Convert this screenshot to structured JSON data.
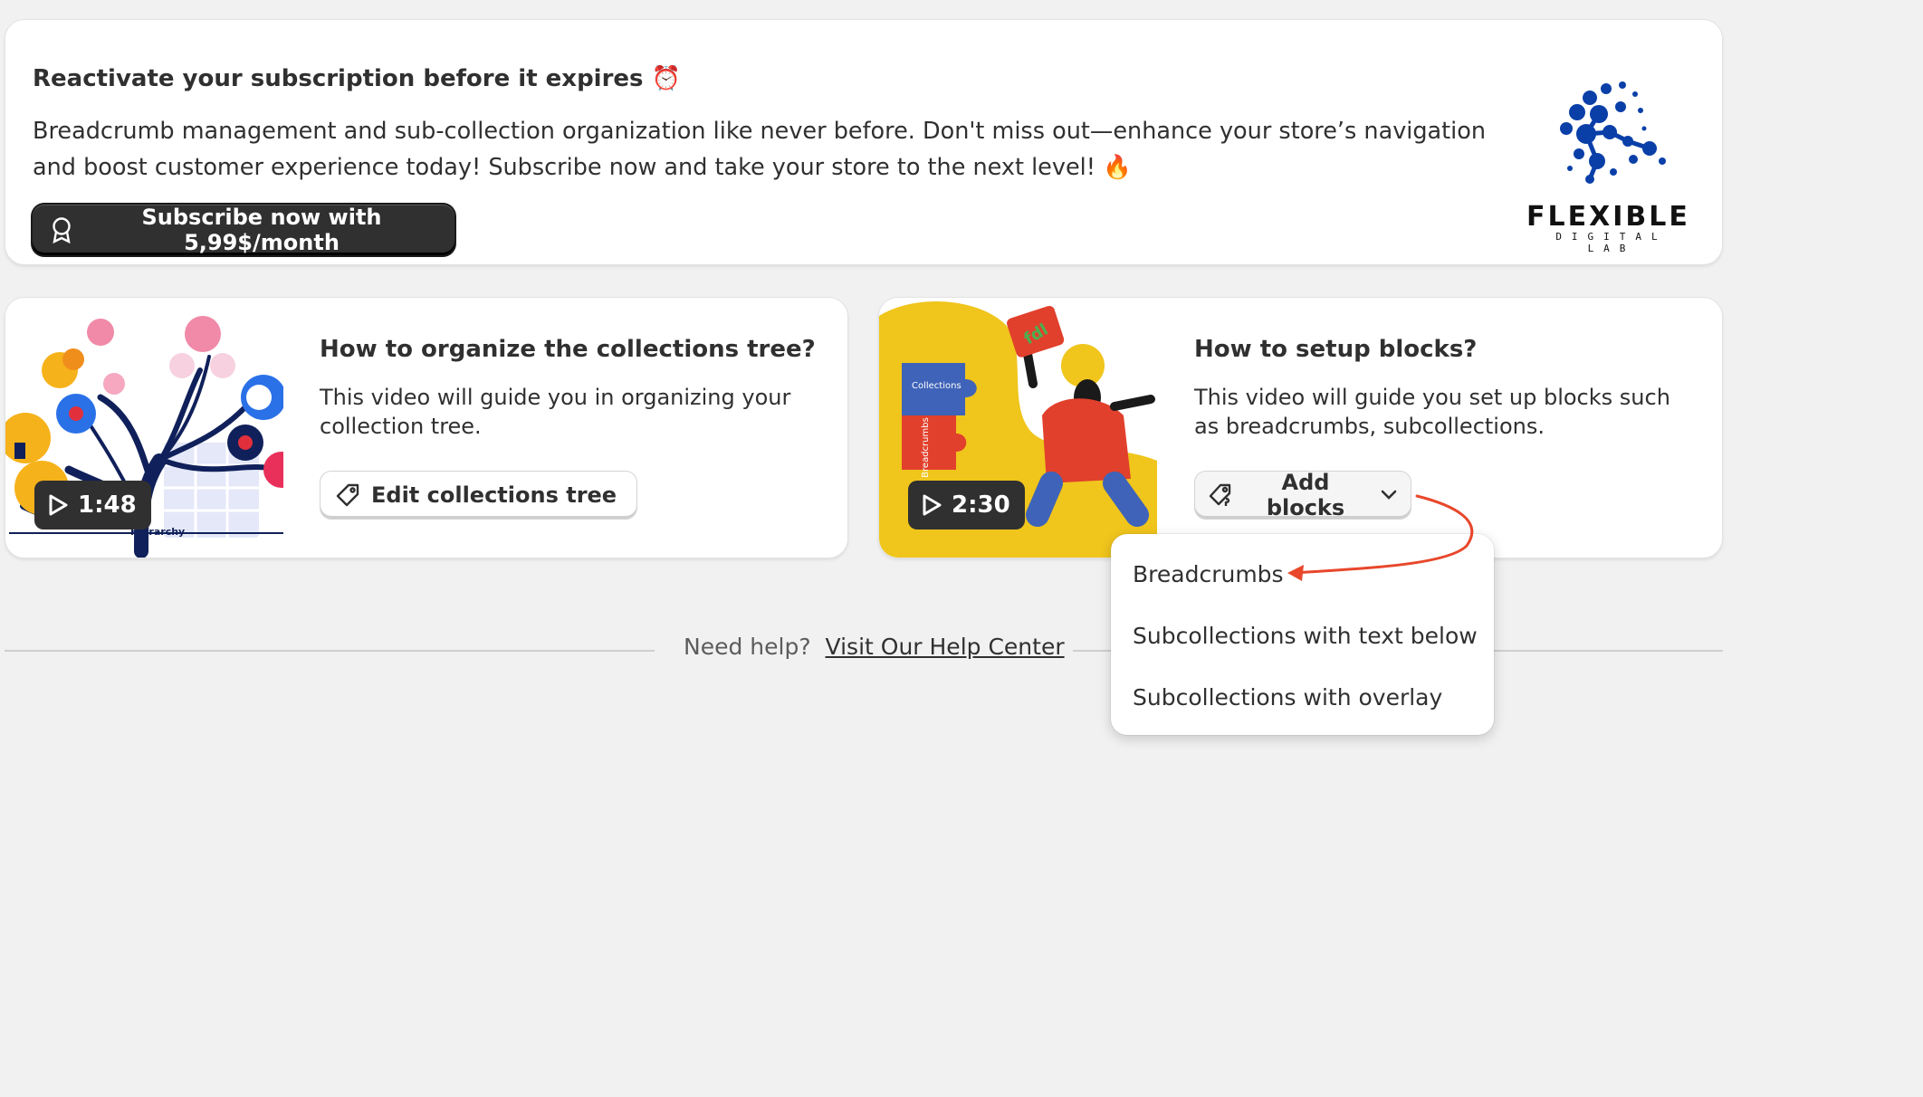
{
  "banner": {
    "title": "Reactivate your subscription before it expires ⏰",
    "body": "Breadcrumb management and sub-collection organization like never before. Don't miss out—enhance your store’s navigation and boost customer experience today! Subscribe now and take your store to the next level! 🔥",
    "subscribe_label": "Subscribe now with 5,99$/month",
    "logo_word": "FLEXIBLE",
    "logo_sub": "DIGITAL LAB"
  },
  "cards": {
    "tree": {
      "duration": "1:48",
      "thumb_caption": "Hierarchy",
      "title": "How to organize the collections tree?",
      "description": "This video will guide you in organizing your collection tree.",
      "button_label": "Edit collections tree"
    },
    "blocks": {
      "duration": "2:30",
      "puzzle_a": "Collections",
      "puzzle_b": "Breadcrumbs",
      "puzzle_c": "fdl",
      "title": "How to setup blocks?",
      "description": "This video will guide you set up blocks such as breadcrumbs, subcollections.",
      "button_label": "Add blocks"
    }
  },
  "dropdown": {
    "items": [
      "Breadcrumbs",
      "Subcollections with text below",
      "Subcollections with overlay"
    ]
  },
  "help": {
    "prefix": "Need help?",
    "link": "Visit Our Help Center"
  },
  "colors": {
    "background": "#f1f1f1",
    "primary_button": "#303030",
    "annotation_arrow": "#e8472b",
    "logo_blue": "#0a3fa8",
    "thumb_yellow": "#f0c51c"
  }
}
